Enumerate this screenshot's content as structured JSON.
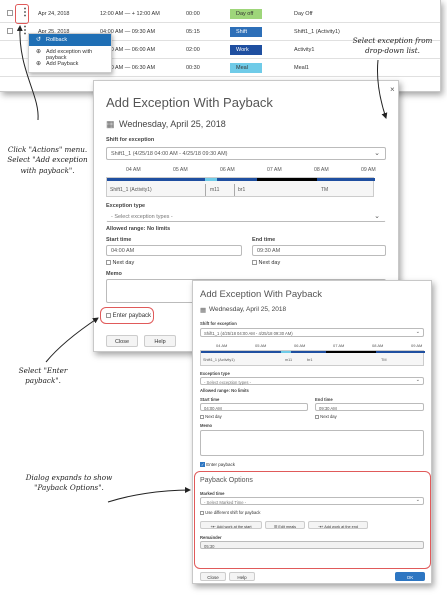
{
  "grid": {
    "rows": [
      {
        "date": "Apr 24, 2018",
        "time": "12:00 AM — + 12:00 AM",
        "duration": "00:00",
        "type": "Day off",
        "name": "Day Off",
        "color": "#9ed67a"
      },
      {
        "date": "Apr 25, 2018",
        "time": "04:00 AM — 09:30 AM",
        "duration": "05:15",
        "type": "Shift",
        "name": "Shift1_1 (Activity1)",
        "color": "#2d6fb8"
      },
      {
        "date": "",
        "time": "04:00 AM — 06:00 AM",
        "duration": "02:00",
        "type": "Work",
        "name": "Activity1",
        "color": "#1f4fa0"
      },
      {
        "date": "",
        "time": "06:00 AM — 06:30 AM",
        "duration": "00:30",
        "type": "Meal",
        "name": "Meal1",
        "color": "#6fcbe8"
      }
    ],
    "actions_icon": "vertical-ellipsis-icon"
  },
  "actions_menu": {
    "items": [
      {
        "label": "Rollback",
        "icon": "rollback-icon"
      },
      {
        "label": "Add exception with payback",
        "icon": "plus-icon"
      },
      {
        "label": "Add Payback",
        "icon": "plus-icon"
      }
    ]
  },
  "dialog1": {
    "title": "Add Exception With Payback",
    "date": "Wednesday, April 25, 2018",
    "shift_label": "Shift for exception",
    "shift_value": "Shift1_1 (4/25/18 04:00 AM - 4/25/18 09:30 AM)",
    "timeline_ticks": [
      "04 AM",
      "05 AM",
      "06 AM",
      "07 AM",
      "08 AM",
      "09 AM"
    ],
    "timeline_segments": [
      "Shift1_1 (Activity1)",
      "m11",
      "br1",
      "TM"
    ],
    "exception_type_label": "Exception type",
    "exception_type_placeholder": "- Select exception types -",
    "allowed_range": "Allowed range: No limits",
    "start_time_label": "Start time",
    "start_time_value": "04:00 AM",
    "end_time_label": "End time",
    "end_time_value": "09:30 AM",
    "next_day": "Next day",
    "memo_label": "Memo",
    "enter_payback": "Enter payback",
    "close_button": "Close",
    "help_button": "Help",
    "close_icon": "close-icon"
  },
  "dialog2": {
    "title": "Add Exception With Payback",
    "date": "Wednesday, April 25, 2018",
    "shift_label": "Shift for exception",
    "shift_value": "Shift1_1 (4/25/18 04:00 AM - 4/25/18 09:30 AM)",
    "timeline_ticks": [
      "04 AM",
      "05 AM",
      "06 AM",
      "07 AM",
      "08 AM",
      "09 AM"
    ],
    "timeline_segments": [
      "Shift1_1 (Activity1)",
      "m11",
      "br1",
      "TM"
    ],
    "exception_type_label": "Exception type",
    "exception_type_placeholder": "- Select exception types -",
    "allowed_range": "Allowed range: No limits",
    "start_time_label": "Start time",
    "start_time_value": "04:00 AM",
    "end_time_label": "End time",
    "end_time_value": "09:30 AM",
    "next_day": "Next day",
    "memo_label": "Memo",
    "enter_payback": "Enter payback",
    "payback_options_title": "Payback Options",
    "marked_time_label": "Marked time",
    "marked_time_placeholder": "- Select Marked Time -",
    "use_different_shift": "Use different shift for payback",
    "add_work_start": "Add work at the start",
    "edit_meals": "Edit meals",
    "add_work_end": "Add work at the end",
    "remainder_label": "Remainder",
    "remainder_value": "05:30",
    "close_button": "Close",
    "help_button": "Help",
    "ok_button": "OK"
  },
  "annotations": {
    "actions": "Click \"Actions\" menu. Select \"Add exception with payback\".",
    "actions_lines": [
      "Click \"Actions\" menu.",
      "Select \"Add exception",
      "with payback\"."
    ],
    "dropdown_lines": [
      "Select exception from",
      "drop-down list."
    ],
    "payback_lines": [
      "Select \"Enter",
      "payback\"."
    ],
    "expand_lines": [
      "Dialog expands to show",
      "\"Payback Options\"."
    ]
  },
  "colors": {
    "accent": "#2d76c2",
    "callout": "#e05a5a",
    "menu_active": "#1f6fb5"
  }
}
